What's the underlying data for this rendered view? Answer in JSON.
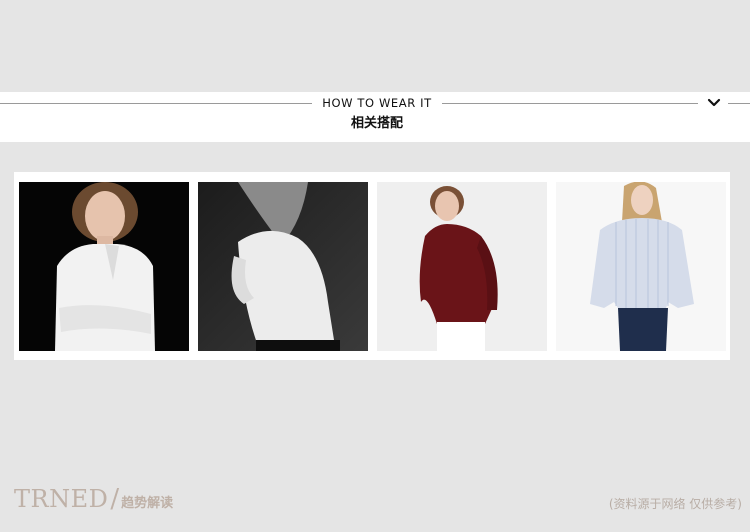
{
  "section": {
    "title_en": "HOW TO WEAR IT",
    "title_zh": "相关搭配",
    "toggle_icon": "chevron-down-icon"
  },
  "gallery": {
    "items": [
      {
        "alt": "white-blouse-black-background"
      },
      {
        "alt": "white-shirt-monochrome"
      },
      {
        "alt": "burgundy-shirt"
      },
      {
        "alt": "striped-light-blue-shirt"
      }
    ]
  },
  "footer": {
    "logo_text": "TRNED",
    "logo_slash": "/",
    "logo_sub": "趋势解读",
    "note": "(资料源于网络 仅供参考)"
  },
  "colors": {
    "background": "#e5e5e5",
    "panel": "#ffffff",
    "logo": "#bfb1a7"
  }
}
